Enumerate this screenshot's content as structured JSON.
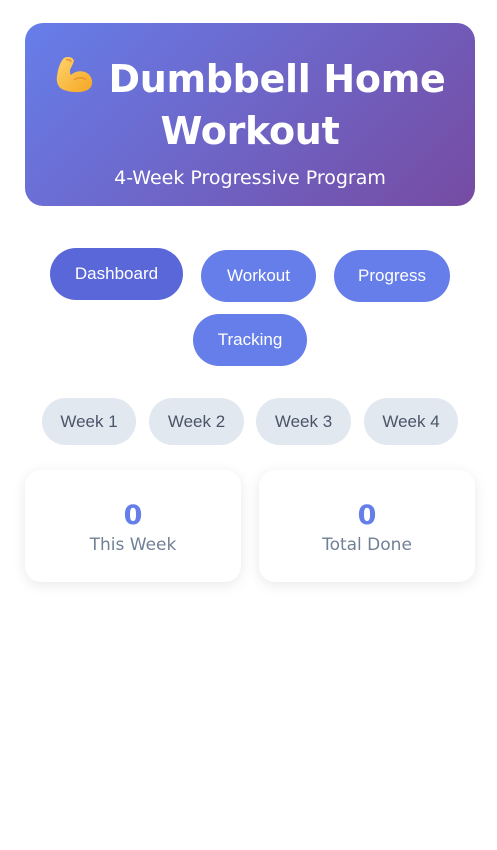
{
  "header": {
    "emoji": "💪",
    "title_line1": "Dumbbell Home",
    "title_line2": "Workout",
    "subtitle": "4-Week Progressive Program"
  },
  "nav": {
    "items": [
      {
        "label": "Dashboard",
        "active": true
      },
      {
        "label": "Workout",
        "active": false
      },
      {
        "label": "Progress",
        "active": false
      },
      {
        "label": "Tracking",
        "active": false
      }
    ]
  },
  "weeks": {
    "items": [
      {
        "label": "Week 1"
      },
      {
        "label": "Week 2"
      },
      {
        "label": "Week 3"
      },
      {
        "label": "Week 4"
      }
    ]
  },
  "stats": [
    {
      "value": "0",
      "label": "This Week"
    },
    {
      "value": "0",
      "label": "Total Done"
    }
  ],
  "colors": {
    "accent": "#667eea",
    "accent_active": "#5a67d8",
    "gradient_end": "#764ba2",
    "week_pill": "#e2e8f0",
    "muted_text": "#718096"
  }
}
